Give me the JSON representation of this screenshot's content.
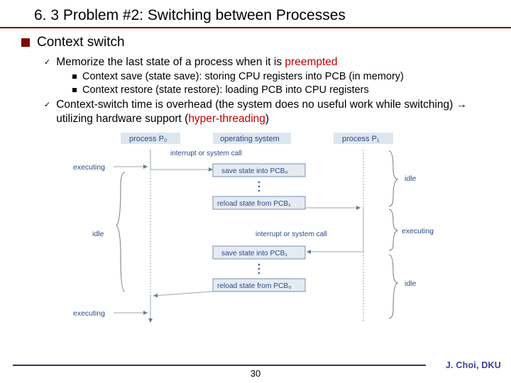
{
  "title": "6. 3 Problem #2: Switching between Processes",
  "lvl1": {
    "context_switch": "Context switch"
  },
  "lvl2": {
    "memorize_pre": "Memorize the last state of a process when it is ",
    "memorize_red": "preempted",
    "overhead_pre": "Context-switch time is overhead (the system does no useful work while switching) ",
    "overhead_arrow": "→",
    "overhead_mid": " utilizing hardware support (",
    "overhead_red": "hyper-threading",
    "overhead_post": ")"
  },
  "lvl3": {
    "save": "Context save (state save): storing CPU registers into PCB (in memory)",
    "restore": "Context restore (state restore): loading PCB into CPU registers"
  },
  "diagram": {
    "headers": {
      "p0": "process P₀",
      "os": "operating system",
      "p1": "process P₁"
    },
    "labels": {
      "executing": "executing",
      "idle": "idle",
      "interrupt": "interrupt or system call"
    },
    "boxes": {
      "save0": "save state into PCB₀",
      "reload1": "reload state from PCB₁",
      "save1": "save state into PCB₁",
      "reload0": "reload state from PCB₀"
    }
  },
  "footer": {
    "page": "30",
    "author": "J. Choi, DKU"
  }
}
